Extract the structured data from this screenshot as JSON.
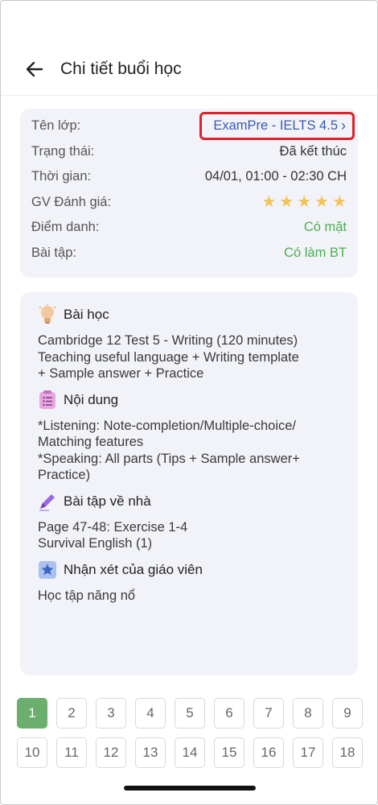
{
  "header": {
    "title": "Chi tiết buổi học"
  },
  "info": {
    "class_label": "Tên lớp:",
    "class_value": "ExamPre - IELTS 4.5",
    "status_label": "Trạng thái:",
    "status_value": "Đã kết thúc",
    "time_label": "Thời gian:",
    "time_value": "04/01, 01:00 - 02:30 CH",
    "rating_label": "GV Đánh giá:",
    "rating_value": 5,
    "rating_max": 5,
    "attendance_label": "Điểm danh:",
    "attendance_value": "Có mặt",
    "homework_label": "Bài tập:",
    "homework_value": "Có làm BT",
    "green_color": "#4caf50",
    "star_color": "#f3c356"
  },
  "detail": {
    "lesson": {
      "title": "Bài học",
      "body": "Cambridge 12 Test 5 - Writing (120 minutes)\nTeaching useful language + Writing template\n+ Sample answer + Practice",
      "icon": "lightbulb-icon"
    },
    "content": {
      "title": "Nội dung",
      "body": "*Listening: Note-completion/Multiple-choice/\nMatching features\n*Speaking: All parts (Tips + Sample answer+\nPractice)",
      "icon": "list-icon"
    },
    "homework": {
      "title": "Bài tập về nhà",
      "body": "Page 47-48: Exercise 1-4\n Survival English (1)",
      "icon": "pen-icon"
    },
    "teacher_comment": {
      "title": "Nhận xét của giáo viên",
      "body": "Học tập năng nổ",
      "icon": "star-badge-icon"
    }
  },
  "pagination": {
    "pages": [
      "1",
      "2",
      "3",
      "4",
      "5",
      "6",
      "7",
      "8",
      "9",
      "10",
      "11",
      "12",
      "13",
      "14",
      "15",
      "16",
      "17",
      "18"
    ],
    "active": "1",
    "active_color": "#6cae6e"
  }
}
